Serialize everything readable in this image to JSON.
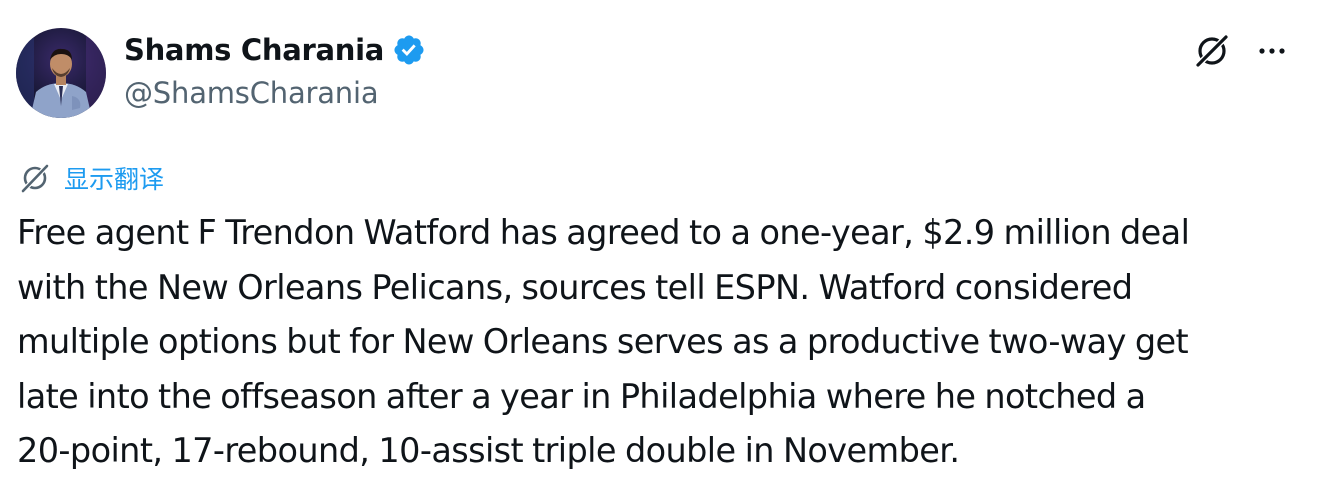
{
  "author": {
    "display_name": "Shams Charania",
    "handle": "@ShamsCharania",
    "verified": true,
    "verified_color": "#1d9bf0",
    "avatar_icon": "avatar-photo"
  },
  "actions": {
    "grok_icon": "grok-icon",
    "more_icon": "more-icon"
  },
  "translate": {
    "label": "显示翻译",
    "icon": "grok-icon",
    "color": "#1d9bf0"
  },
  "tweet": {
    "lines": [
      "Free agent F Trendon Watford has agreed to a one-year, $2.9 million deal",
      "with the New Orleans Pelicans, sources tell ESPN. Watford considered",
      "multiple options but for New Orleans serves as a productive two-way get",
      "late into the offseason after a year in Philadelphia where he notched a",
      "20-point, 17-rebound, 10-assist triple double in November."
    ]
  },
  "colors": {
    "text": "#0f1419",
    "secondary": "#536471",
    "accent": "#1d9bf0"
  }
}
